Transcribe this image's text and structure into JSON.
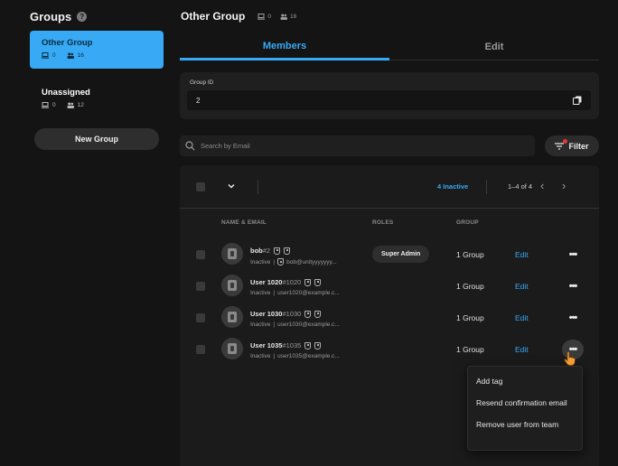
{
  "sidebar": {
    "title": "Groups",
    "help_icon": "?",
    "groups": [
      {
        "name": "Other Group",
        "devices": "0",
        "users": "16",
        "active": true
      },
      {
        "name": "Unassigned",
        "devices": "0",
        "users": "12",
        "active": false
      }
    ],
    "new_group_label": "New Group"
  },
  "header": {
    "title": "Other Group",
    "devices": "0",
    "users": "16"
  },
  "tabs": [
    {
      "label": "Members",
      "active": true
    },
    {
      "label": "Edit",
      "active": false
    }
  ],
  "group_id": {
    "label": "Group ID",
    "value": "2"
  },
  "search": {
    "placeholder": "Search by Email"
  },
  "filter": {
    "label": "Filter"
  },
  "table": {
    "inactive_count": "4 Inactive",
    "paging": "1–4 of 4",
    "columns": {
      "name": "NAME & EMAIL",
      "roles": "ROLES",
      "group": "GROUP"
    },
    "rows": [
      {
        "name": "bob",
        "uid": "#2",
        "status": "Inactive",
        "email": "bob@unityyyyyyy...",
        "role": "Super Admin",
        "group": "1 Group",
        "edit": "Edit"
      },
      {
        "name": "User 1020",
        "uid": "#1020",
        "status": "Inactive",
        "email": "user1020@example.c...",
        "role": "",
        "group": "1 Group",
        "edit": "Edit"
      },
      {
        "name": "User 1030",
        "uid": "#1030",
        "status": "Inactive",
        "email": "user1030@example.c...",
        "role": "",
        "group": "1 Group",
        "edit": "Edit"
      },
      {
        "name": "User 1035",
        "uid": "#1035",
        "status": "Inactive",
        "email": "user1035@example.c...",
        "role": "",
        "group": "1 Group",
        "edit": "Edit"
      }
    ]
  },
  "context_menu": {
    "items": [
      "Add tag",
      "Resend confirmation email",
      "Remove user from team"
    ]
  },
  "colors": {
    "accent": "#37a9f5",
    "background": "#141414",
    "panel": "#1b1b1b",
    "filter_dot": "#e53935",
    "cursor": "#f39c38"
  }
}
